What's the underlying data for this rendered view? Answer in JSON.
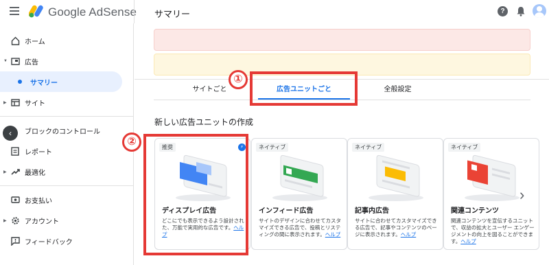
{
  "app": {
    "brand": "Google AdSense",
    "page_title": "サマリー"
  },
  "sidebar": {
    "items": [
      {
        "label": "ホーム",
        "icon": "home-icon"
      },
      {
        "label": "広告",
        "icon": "ads-icon"
      },
      {
        "label": "サマリー",
        "icon": "dot-icon"
      },
      {
        "label": "サイト",
        "icon": "sites-icon"
      },
      {
        "label": "ブロックのコントロール",
        "icon": "block-icon"
      },
      {
        "label": "レポート",
        "icon": "reports-icon"
      },
      {
        "label": "最適化",
        "icon": "trending-up-icon"
      },
      {
        "label": "お支払い",
        "icon": "payments-icon"
      },
      {
        "label": "アカウント",
        "icon": "gear-icon"
      },
      {
        "label": "フィードバック",
        "icon": "feedback-icon"
      }
    ]
  },
  "tabs": [
    {
      "label": "サイトごと"
    },
    {
      "label": "広告ユニットごと"
    },
    {
      "label": "全般設定"
    }
  ],
  "annotations": {
    "one": "①",
    "two": "②"
  },
  "section": {
    "title": "新しい広告ユニットの作成"
  },
  "cards": [
    {
      "badge": "推奨",
      "title": "ディスプレイ広告",
      "desc": "どこにでも表示できるよう設計された、万能で実用的な広告です。",
      "link": "ヘルプ",
      "accent": "#4285f4"
    },
    {
      "badge": "ネイティブ",
      "title": "インフィード広告",
      "desc": "サイトのデザインに合わせてカスタマイズできる広告で、投稿とリスティングの間に表示されます。",
      "link": "ヘルプ",
      "accent": "#34a853"
    },
    {
      "badge": "ネイティブ",
      "title": "記事内広告",
      "desc": "サイトに合わせてカスタマイズできる広告で、記事やコンテンツのページに表示されます。",
      "link": "ヘルプ",
      "accent": "#fbbc04"
    },
    {
      "badge": "ネイティブ",
      "title": "関連コンテンツ",
      "desc": "関連コンテンツを宣伝するユニットで、収益の拡大とユーザー エンゲージメントの向上を図ることができます。",
      "link": "ヘルプ",
      "accent": "#ea4335"
    }
  ],
  "colors": {
    "accent": "#1a73e8",
    "annotation": "#e53935"
  }
}
